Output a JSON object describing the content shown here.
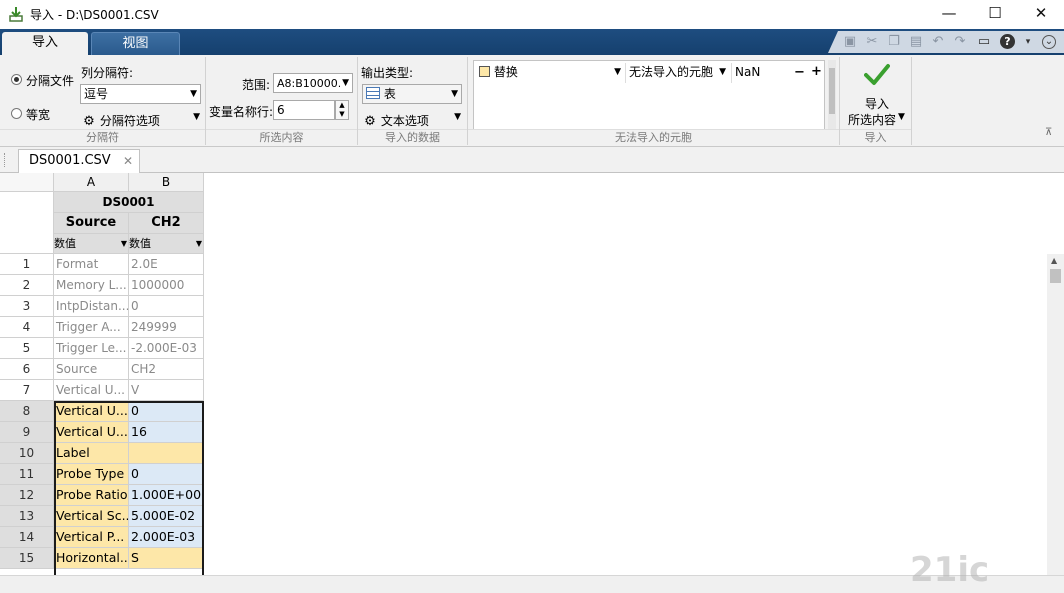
{
  "window": {
    "title": "导入 - D:\\DS0001.CSV",
    "minimize": "—",
    "maximize": "☐",
    "close": "✕"
  },
  "ribbon_tabs": [
    "导入",
    "视图"
  ],
  "delimiter_group": {
    "radio_delimited": "分隔文件",
    "radio_fixed": "等宽",
    "column_delimiter_label": "列分隔符:",
    "delimiter_value": "逗号",
    "options_label": "分隔符选项",
    "group_label": "分隔符"
  },
  "selection_group": {
    "range_label": "范围:",
    "range_value": "A8:B10000...",
    "varname_row_label": "变量名称行:",
    "varname_row_value": "6",
    "group_label": "所选内容"
  },
  "output_group": {
    "output_type_label": "输出类型:",
    "output_type_value": "表",
    "text_options_label": "文本选项",
    "group_label": "导入的数据"
  },
  "unimportable_group": {
    "action_value": "替换",
    "cell_type_value": "无法导入的元胞",
    "replacement_value": "NaN",
    "minus": "−",
    "plus": "+",
    "group_label": "无法导入的元胞"
  },
  "import_group": {
    "import_label_line1": "导入",
    "import_label_line2": "所选内容",
    "group_label": "导入"
  },
  "doc_tab": {
    "label": "DS0001.CSV",
    "close": "✕"
  },
  "grid": {
    "col_letters": [
      "A",
      "B"
    ],
    "table_name": "DS0001",
    "var_names": [
      "Source",
      "CH2"
    ],
    "var_types": [
      "数值",
      "数值"
    ],
    "rows": [
      {
        "n": "1",
        "a": "Format",
        "b": "2.0E"
      },
      {
        "n": "2",
        "a": "Memory L...",
        "b": "1000000"
      },
      {
        "n": "3",
        "a": "IntpDistan...",
        "b": "0"
      },
      {
        "n": "4",
        "a": "Trigger A...",
        "b": "249999"
      },
      {
        "n": "5",
        "a": "Trigger Le...",
        "b": "-2.000E-03"
      },
      {
        "n": "6",
        "a": "Source",
        "b": "CH2"
      },
      {
        "n": "7",
        "a": "Vertical U...",
        "b": "V"
      },
      {
        "n": "8",
        "a": "Vertical U...",
        "b": "0"
      },
      {
        "n": "9",
        "a": "Vertical U...",
        "b": "16"
      },
      {
        "n": "10",
        "a": "Label",
        "b": ""
      },
      {
        "n": "11",
        "a": "Probe Type",
        "b": "0"
      },
      {
        "n": "12",
        "a": "Probe Ratio",
        "b": "1.000E+00"
      },
      {
        "n": "13",
        "a": "Vertical Sc...",
        "b": "5.000E-02"
      },
      {
        "n": "14",
        "a": "Vertical P...",
        "b": "2.000E-03"
      },
      {
        "n": "15",
        "a": "Horizontal...",
        "b": "S"
      }
    ]
  },
  "icons": {
    "app": "import-icon",
    "check": "checkmark-icon",
    "gear": "gear-icon",
    "table": "table-icon"
  },
  "colors": {
    "ribbon_blue": "#1e4d80",
    "selected_text_col": "#fde7a8",
    "selected_num_col": "#dce9f6",
    "check_green": "#3aa02f"
  }
}
